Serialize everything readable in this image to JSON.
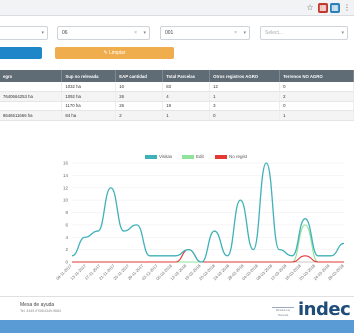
{
  "browser": {
    "toolbar_icons": [
      "star-icon",
      "extension-icon",
      "extension-icon",
      "menu-icon"
    ]
  },
  "filters": [
    {
      "value": "06",
      "placeholder": ""
    },
    {
      "value": "001",
      "placeholder": ""
    },
    {
      "value": "",
      "placeholder": "Select..."
    }
  ],
  "buttons": {
    "clear_label": "Limpiar",
    "clear_icon": "eraser-icon"
  },
  "table": {
    "headers": [
      "egro",
      "Sup no relevada",
      "EAP cantidad",
      "Total Parcelas",
      "Otros registros AGRO",
      "Terrenos NO AGRO"
    ],
    "rows": [
      [
        "",
        "1032 ha",
        "10",
        "83",
        "12",
        "0"
      ],
      [
        "7640664253 ha",
        "1092 ha",
        "26",
        "4",
        "1",
        "2"
      ],
      [
        "",
        "1170 ha",
        "26",
        "19",
        "3",
        "0"
      ],
      [
        "8646511666 ha",
        "84 ha",
        "2",
        "1",
        "0",
        "1"
      ]
    ]
  },
  "chart_data": {
    "type": "line",
    "x": [
      "09-11-2017",
      "13-11-2017",
      "17-11-2017",
      "21-11-2017",
      "25-11-2017",
      "29-11-2017",
      "03-12-2017",
      "05-02-2018",
      "12-02-2018",
      "16-02-2018",
      "20-02-2018",
      "24-02-2018",
      "28-02-2018",
      "04-03-2018",
      "08-03-2018",
      "12-03-2018",
      "16-03-2018",
      "20-03-2018",
      "24-03-2018",
      "28-03-2018"
    ],
    "series": [
      {
        "name": "Visitas",
        "color": "#3fb1b8",
        "values": [
          1,
          4,
          5,
          12,
          5,
          6,
          1,
          1,
          1,
          2,
          0,
          5,
          1,
          10,
          2,
          16,
          2,
          1,
          7,
          1,
          1,
          3
        ]
      },
      {
        "name": "Edit",
        "color": "#90e39b",
        "values": [
          0,
          0,
          0,
          0,
          0,
          0,
          0,
          0,
          0,
          0,
          0,
          0,
          0,
          0,
          0,
          0,
          0,
          0,
          6,
          0,
          0,
          0
        ]
      },
      {
        "name": "No regist",
        "color": "#e53935",
        "values": [
          0,
          0,
          0,
          0,
          0,
          0,
          0,
          0,
          0,
          2,
          0,
          0,
          0,
          0,
          0,
          0,
          0,
          0,
          1,
          0,
          0,
          0
        ]
      }
    ],
    "yticks": [
      0,
      2,
      4,
      6,
      8,
      10,
      12,
      14,
      16
    ],
    "ylim": [
      0,
      16
    ],
    "xlabel": "",
    "ylabel": "",
    "grid": true,
    "legend": "top-center"
  },
  "footer": {
    "help_label": "Mesa de ayuda",
    "help_contact": "Tel. 4349-9706/4349-9684",
    "ministry_label": "Ministerio de Hacienda",
    "logo_text": "indec"
  }
}
